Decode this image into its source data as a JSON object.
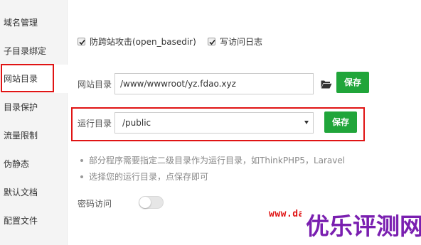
{
  "sidebar": {
    "items": [
      {
        "label": "域名管理"
      },
      {
        "label": "子目录绑定"
      },
      {
        "label": "网站目录"
      },
      {
        "label": "目录保护"
      },
      {
        "label": "流量限制"
      },
      {
        "label": "伪静态"
      },
      {
        "label": "默认文档"
      },
      {
        "label": "配置文件"
      }
    ],
    "active_index": 2
  },
  "options": {
    "anti_xss": {
      "label": "防跨站攻击(open_basedir)",
      "checked": true
    },
    "access_log": {
      "label": "写访问日志",
      "checked": true
    }
  },
  "site_dir": {
    "label": "网站目录",
    "value": "/www/wwwroot/yz.fdao.xyz",
    "folder_icon": "folder-open-icon",
    "save_label": "保存"
  },
  "run_dir": {
    "label": "运行目录",
    "selected": "/public",
    "save_label": "保存"
  },
  "tips": [
    "部分程序需要指定二级目录作为运行目录，如ThinkPHP5，Laravel",
    "选择您的运行目录，点保存即可"
  ],
  "password_access": {
    "label": "密码访问",
    "enabled": false
  },
  "watermark": {
    "url": "www.da",
    "brand": "优乐评测网"
  },
  "colors": {
    "accent_green": "#20a53a",
    "highlight_red": "#e01414",
    "brand_purple": "#7a1fb0"
  }
}
